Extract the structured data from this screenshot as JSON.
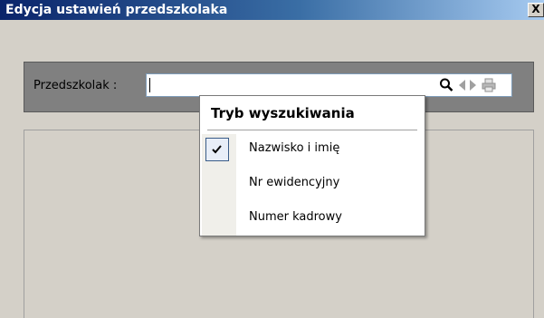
{
  "window": {
    "title": "Edycja ustawień przedszkolaka",
    "close_label": "X"
  },
  "search": {
    "label": "Przedszkolak :",
    "value": ""
  },
  "popup": {
    "title": "Tryb wyszukiwania",
    "items": [
      {
        "label": "Nazwisko i imię",
        "checked": true
      },
      {
        "label": "Nr ewidencyjny",
        "checked": false
      },
      {
        "label": "Numer kadrowy",
        "checked": false
      }
    ]
  },
  "icons": [
    "search-icon",
    "prev-icon",
    "next-icon",
    "print-icon",
    "check-icon"
  ],
  "colors": {
    "title_start": "#0a246a",
    "title_end": "#a6caf0",
    "panel_dark": "#808080",
    "window_bg": "#d4d0c8"
  }
}
